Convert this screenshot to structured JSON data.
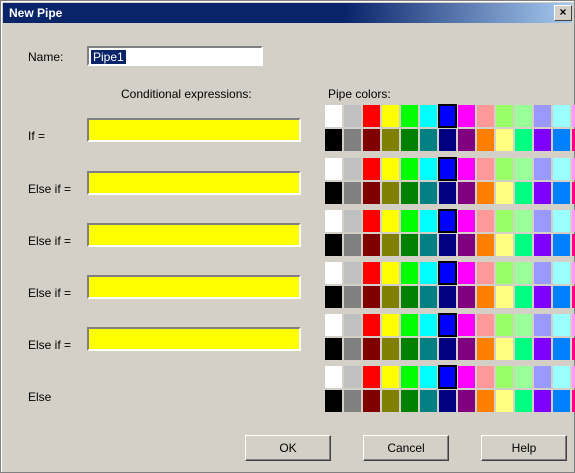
{
  "window": {
    "title": "New Pipe",
    "close_glyph": "×"
  },
  "name": {
    "label": "Name:",
    "value": "Pipe1"
  },
  "headers": {
    "conditional": "Conditional expressions:",
    "colors": "Pipe colors:"
  },
  "rows": [
    {
      "label": "If =",
      "has_input": true,
      "value": "",
      "selected_color": "#0000ff"
    },
    {
      "label": "Else if =",
      "has_input": true,
      "value": "",
      "selected_color": "#0000ff"
    },
    {
      "label": "Else if =",
      "has_input": true,
      "value": "",
      "selected_color": "#0000ff"
    },
    {
      "label": "Else if =",
      "has_input": true,
      "value": "",
      "selected_color": "#0000ff"
    },
    {
      "label": "Else if =",
      "has_input": true,
      "value": "",
      "selected_color": "#0000ff"
    },
    {
      "label": "Else",
      "has_input": false,
      "value": "",
      "selected_color": "#0000ff"
    }
  ],
  "palette": {
    "top": [
      "#ffffff",
      "#c0c0c0",
      "#ff0000",
      "#ffff00",
      "#00ff00",
      "#00ffff",
      "#0000ff",
      "#ff00ff",
      "#ff9999",
      "#99ff66",
      "#99ff99",
      "#9999ff",
      "#99ffff",
      "#ff99ff"
    ],
    "bottom": [
      "#000000",
      "#808080",
      "#800000",
      "#808000",
      "#008000",
      "#008080",
      "#000080",
      "#800080",
      "#ff8000",
      "#ffff80",
      "#00ff80",
      "#8000ff",
      "#0080ff",
      "#ff0080"
    ]
  },
  "buttons": {
    "ok": "OK",
    "cancel": "Cancel",
    "help": "Help"
  }
}
